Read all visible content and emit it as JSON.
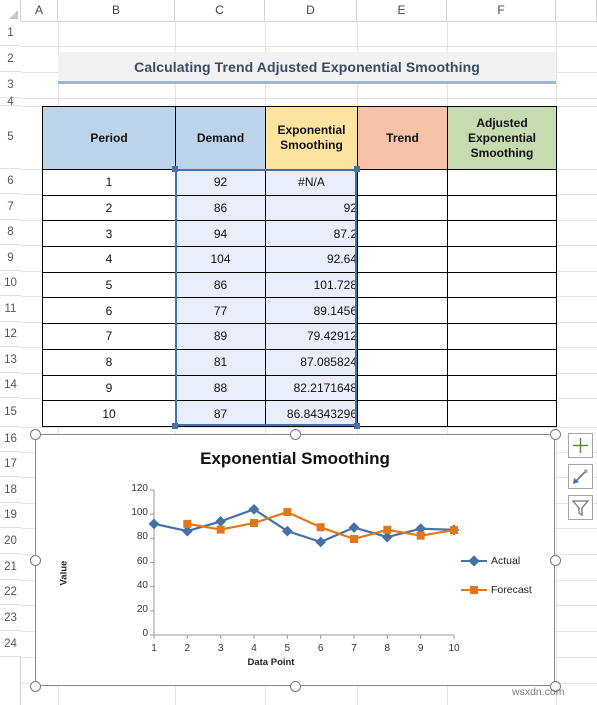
{
  "spreadsheet": {
    "column_headers": [
      "A",
      "B",
      "C",
      "D",
      "E",
      "F"
    ],
    "row_headers": [
      "1",
      "2",
      "3",
      "4",
      "5",
      "6",
      "7",
      "8",
      "9",
      "10",
      "11",
      "12",
      "13",
      "14",
      "15",
      "16",
      "17",
      "18",
      "19",
      "20",
      "21",
      "22",
      "23",
      "24"
    ],
    "title": "Calculating Trend Adjusted Exponential Smoothing",
    "watermark": "wsxdn.com",
    "selection_range": "C5:D14"
  },
  "table": {
    "headers": [
      "Period",
      "Demand",
      "Exponential Smoothing",
      "Trend",
      "Adjusted Exponential Smoothing"
    ],
    "header_colors": [
      "#bcd3ea",
      "#bcd3ea",
      "#fce4a0",
      "#f6c3a8",
      "#c6dcb0"
    ],
    "rows": [
      {
        "period": "1",
        "demand": "92",
        "smoothing": "#N/A",
        "trend": "",
        "adjusted": ""
      },
      {
        "period": "2",
        "demand": "86",
        "smoothing": "92",
        "trend": "",
        "adjusted": ""
      },
      {
        "period": "3",
        "demand": "94",
        "smoothing": "87.2",
        "trend": "",
        "adjusted": ""
      },
      {
        "period": "4",
        "demand": "104",
        "smoothing": "92.64",
        "trend": "",
        "adjusted": ""
      },
      {
        "period": "5",
        "demand": "86",
        "smoothing": "101.728",
        "trend": "",
        "adjusted": ""
      },
      {
        "period": "6",
        "demand": "77",
        "smoothing": "89.1456",
        "trend": "",
        "adjusted": ""
      },
      {
        "period": "7",
        "demand": "89",
        "smoothing": "79.42912",
        "trend": "",
        "adjusted": ""
      },
      {
        "period": "8",
        "demand": "81",
        "smoothing": "87.085824",
        "trend": "",
        "adjusted": ""
      },
      {
        "period": "9",
        "demand": "88",
        "smoothing": "82.2171648",
        "trend": "",
        "adjusted": ""
      },
      {
        "period": "10",
        "demand": "87",
        "smoothing": "86.84343296",
        "trend": "",
        "adjusted": ""
      }
    ]
  },
  "chart_buttons": [
    {
      "name": "chart-elements-button",
      "glyph": "plus"
    },
    {
      "name": "chart-styles-button",
      "glyph": "brush"
    },
    {
      "name": "chart-filters-button",
      "glyph": "funnel"
    }
  ],
  "chart_data": {
    "type": "line",
    "title": "Exponential Smoothing",
    "xlabel": "Data Point",
    "ylabel": "Value",
    "x": [
      1,
      2,
      3,
      4,
      5,
      6,
      7,
      8,
      9,
      10
    ],
    "xticks": [
      "1",
      "2",
      "3",
      "4",
      "5",
      "6",
      "7",
      "8",
      "9",
      "10"
    ],
    "yticks": [
      "0",
      "20",
      "40",
      "60",
      "80",
      "100",
      "120"
    ],
    "ylim": [
      0,
      120
    ],
    "grid": false,
    "legend_position": "right",
    "series": [
      {
        "name": "Actual",
        "color": "#4472a8",
        "marker": "diamond",
        "values": [
          92,
          86,
          94,
          104,
          86,
          77,
          89,
          81,
          88,
          87
        ]
      },
      {
        "name": "Forecast",
        "color": "#e2761b",
        "marker": "square",
        "values": [
          null,
          92,
          87.2,
          92.64,
          101.728,
          89.1456,
          79.42912,
          87.085824,
          82.2171648,
          86.84343296
        ]
      }
    ]
  }
}
